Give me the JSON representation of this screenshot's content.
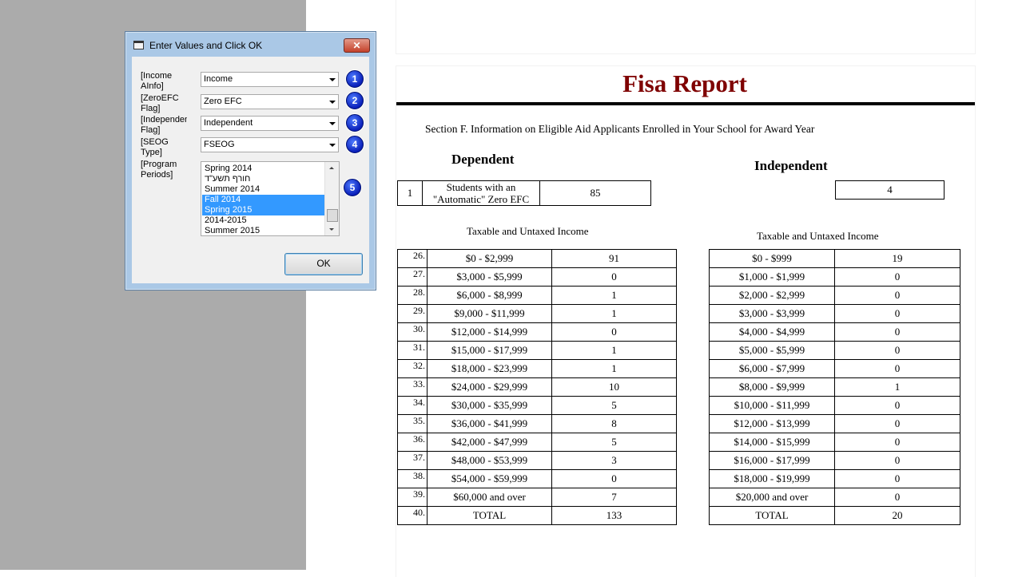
{
  "report": {
    "title": "Fisa Report",
    "section_text": "Section F. Information on Eligible Aid Applicants Enrolled in Your School for Award Year",
    "dependent_heading": "Dependent",
    "independent_heading": "Independent",
    "zero_efc": {
      "row_num": "1",
      "label": "Students with an \"Automatic\" Zero EFC",
      "dependent_value": "85",
      "independent_value": "4"
    },
    "income_label": "Taxable and Untaxed Income",
    "dependent_rows": [
      {
        "num": "26.",
        "range": "$0 - $2,999",
        "value": "91"
      },
      {
        "num": "27.",
        "range": "$3,000 - $5,999",
        "value": "0"
      },
      {
        "num": "28.",
        "range": "$6,000 - $8,999",
        "value": "1"
      },
      {
        "num": "29.",
        "range": "$9,000 - $11,999",
        "value": "1"
      },
      {
        "num": "30.",
        "range": "$12,000 - $14,999",
        "value": "0"
      },
      {
        "num": "31.",
        "range": "$15,000 - $17,999",
        "value": "1"
      },
      {
        "num": "32.",
        "range": "$18,000 - $23,999",
        "value": "1"
      },
      {
        "num": "33.",
        "range": "$24,000 - $29,999",
        "value": "10"
      },
      {
        "num": "34.",
        "range": "$30,000 - $35,999",
        "value": "5"
      },
      {
        "num": "35.",
        "range": "$36,000 - $41,999",
        "value": "8"
      },
      {
        "num": "36.",
        "range": "$42,000 - $47,999",
        "value": "5"
      },
      {
        "num": "37.",
        "range": "$48,000 - $53,999",
        "value": "3"
      },
      {
        "num": "38.",
        "range": "$54,000 - $59,999",
        "value": "0"
      },
      {
        "num": "39.",
        "range": "$60,000 and over",
        "value": "7"
      },
      {
        "num": "40.",
        "range": "TOTAL",
        "value": "133"
      }
    ],
    "independent_rows": [
      {
        "range": "$0 - $999",
        "value": "19"
      },
      {
        "range": "$1,000 - $1,999",
        "value": "0"
      },
      {
        "range": "$2,000 - $2,999",
        "value": "0"
      },
      {
        "range": "$3,000 - $3,999",
        "value": "0"
      },
      {
        "range": "$4,000 - $4,999",
        "value": "0"
      },
      {
        "range": "$5,000 - $5,999",
        "value": "0"
      },
      {
        "range": "$6,000 - $7,999",
        "value": "0"
      },
      {
        "range": "$8,000 - $9,999",
        "value": "1"
      },
      {
        "range": "$10,000 - $11,999",
        "value": "0"
      },
      {
        "range": "$12,000 - $13,999",
        "value": "0"
      },
      {
        "range": "$14,000 - $15,999",
        "value": "0"
      },
      {
        "range": "$16,000 - $17,999",
        "value": "0"
      },
      {
        "range": "$18,000 - $19,999",
        "value": "0"
      },
      {
        "range": "$20,000 and over",
        "value": "0"
      },
      {
        "range": "TOTAL",
        "value": "20"
      }
    ]
  },
  "dialog": {
    "title": "Enter Values and Click OK",
    "close_label": "✕",
    "fields": [
      {
        "label": "[Income\nAInfo]",
        "value": "Income",
        "badge": "1"
      },
      {
        "label": "[ZeroEFC\nFlag]",
        "value": "Zero EFC",
        "badge": "2"
      },
      {
        "label": "[Independent\nFlag]",
        "value": "Independent",
        "badge": "3"
      },
      {
        "label": "[SEOG\nType]",
        "value": "FSEOG",
        "badge": "4"
      }
    ],
    "list_field": {
      "label": "[Program\nPeriods]",
      "badge": "5",
      "items": [
        {
          "text": "Spring 2014",
          "selected": false
        },
        {
          "text": "חורף תשע\"ד",
          "selected": false
        },
        {
          "text": "Summer 2014",
          "selected": false
        },
        {
          "text": "Fall 2014",
          "selected": true
        },
        {
          "text": "Spring 2015",
          "selected": true
        },
        {
          "text": "2014-2015",
          "selected": false
        },
        {
          "text": "Summer 2015",
          "selected": false
        }
      ]
    },
    "ok_label": "OK"
  },
  "colors": {
    "title_red": "#7f0000",
    "selection_blue": "#3399ff",
    "badge_blue": "#0a1fb8"
  }
}
